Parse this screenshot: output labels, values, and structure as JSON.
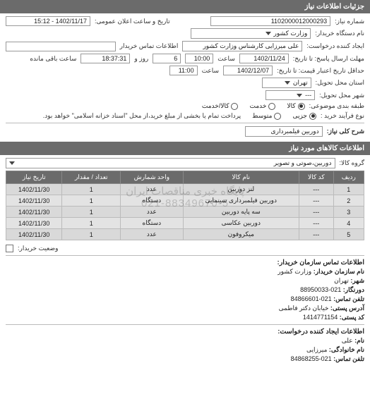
{
  "header": {
    "title": "جزئیات اطلاعات نیاز"
  },
  "top": {
    "req_no_lbl": "شماره نیاز:",
    "req_no": "1102000012000293",
    "ann_lbl": "تاریخ و ساعت اعلان عمومی:",
    "ann_val": "1402/11/17 - 15:12",
    "buyer_dev_lbl": "نام دستگاه خریدار:",
    "buyer_dev": "وزارت کشور",
    "creator_lbl": "ایجاد کننده درخواست:",
    "creator": "علی میرزایی کارشناس وزارت کشور",
    "buyer_contact_lbl": "اطلاعات تماس خریدار"
  },
  "deadlines": {
    "deadline_resp_lbl": "مهلت ارسال پاسخ: تا تاریخ:",
    "deadline_resp_date": "1402/11/24",
    "time_lbl": "ساعت",
    "deadline_resp_time": "10:00",
    "remain_days": "6",
    "day_word": "روز و",
    "remain_time": "18:37:31",
    "remain_tail": "ساعت باقی مانده",
    "valid_lbl": "حداقل تاریخ اعتبار قیمت: تا تاریخ:",
    "valid_date": "1402/12/07",
    "valid_time": "11:00"
  },
  "loc": {
    "delivery_prov_lbl": "استان محل تحویل:",
    "delivery_prov": "تهران",
    "delivery_city_lbl": "شهر محل تحویل:",
    "delivery_city": "---"
  },
  "type": {
    "cat_lbl": "طبقه بندی موضوعی:",
    "opt_goods": "کالا",
    "opt_service": "خدمت",
    "opt_goods_service": "کالا/خدمت"
  },
  "proc": {
    "proc_lbl": "نوع فرآیند خرید :",
    "opt_micro": "جزیی",
    "opt_med": "متوسط",
    "proc_note": "پرداخت تمام یا بخشی از مبلغ خرید،از محل \"اسناد خزانه اسلامی\" خواهد بود."
  },
  "need": {
    "title_lbl": "شرح کلی نیاز:",
    "title_val": "دوربین فیلمبرداری"
  },
  "goods_header": "اطلاعات کالاهای مورد نیاز",
  "group": {
    "lbl": "گروه کالا:",
    "val": "دوربین،صوتی و تصویر"
  },
  "table": {
    "headers": {
      "row": "ردیف",
      "code": "کد کالا",
      "name": "نام کالا",
      "unit": "واحد شمارش",
      "qty": "تعداد / مقدار",
      "date": "تاریخ نیاز"
    },
    "rows": [
      {
        "row": "1",
        "code": "---",
        "name": "لنز دوربین",
        "unit": "عدد",
        "qty": "1",
        "date": "1402/11/30"
      },
      {
        "row": "2",
        "code": "---",
        "name": "دوربین فیلمبرداری سینمایی",
        "unit": "دستگاه",
        "qty": "1",
        "date": "1402/11/30"
      },
      {
        "row": "3",
        "code": "---",
        "name": "سه پایه دوربین",
        "unit": "عدد",
        "qty": "1",
        "date": "1402/11/30"
      },
      {
        "row": "4",
        "code": "---",
        "name": "دوربین عکاسی",
        "unit": "دستگاه",
        "qty": "1",
        "date": "1402/11/30"
      },
      {
        "row": "5",
        "code": "---",
        "name": "میکروفون",
        "unit": "عدد",
        "qty": "1",
        "date": "1402/11/30"
      }
    ]
  },
  "watermark_lines": [
    "پایگاه خبری مناقصات ایران",
    "021-88349670-5"
  ],
  "buyer_cb_lbl": "وضعیت خریدار:",
  "contact_org": {
    "title": "اطلاعات تماس سازمان خریدار:",
    "org_lbl": "نام سازمان خریدار:",
    "org": "وزارت کشور",
    "city_lbl": "شهر:",
    "city": "تهران",
    "fax_lbl": "دورنگار:",
    "fax": "021-88950033",
    "tel_lbl": "تلفن تماس:",
    "tel": "021-84866601",
    "addr_lbl": "آدرس پستی:",
    "addr": "خیابان دکتر فاطمی",
    "post_lbl": "کد پستی:",
    "post": "1414771154"
  },
  "contact_creator": {
    "title": "اطلاعات ایجاد کننده درخواست:",
    "fname_lbl": "نام:",
    "fname": "علی",
    "lname_lbl": "نام خانوادگی:",
    "lname": "میرزایی",
    "tel_lbl": "تلفن تماس:",
    "tel": "021-84868255"
  }
}
